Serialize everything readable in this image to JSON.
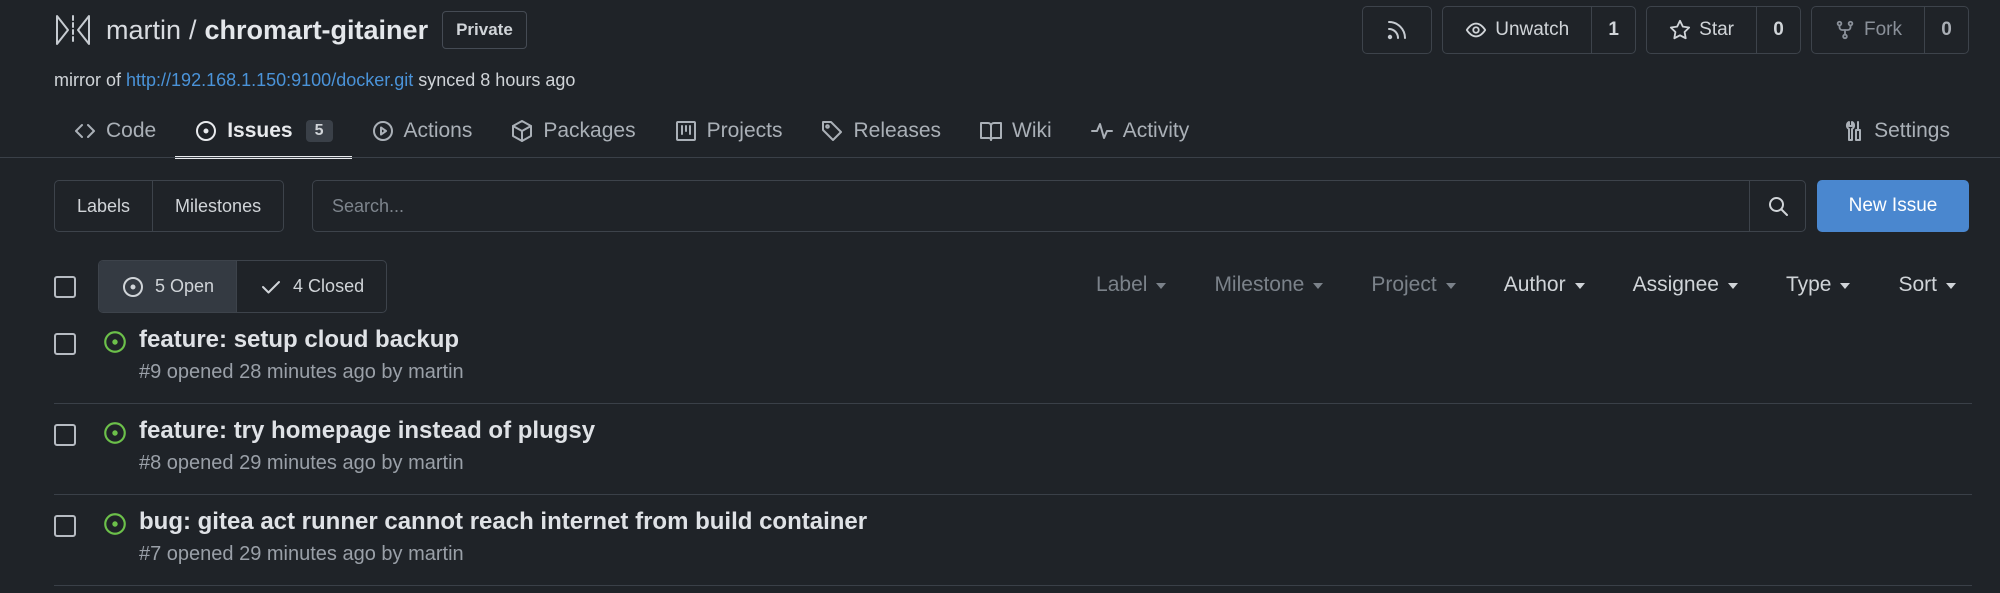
{
  "repo": {
    "owner": "martin",
    "separator": "/",
    "name": "chromart-gitainer",
    "visibility": "Private",
    "mirror_prefix": "mirror of",
    "mirror_url": "http://192.168.1.150:9100/docker.git",
    "mirror_suffix": "synced 8 hours ago"
  },
  "actions": {
    "watch_label": "Unwatch",
    "watch_count": "1",
    "star_label": "Star",
    "star_count": "0",
    "fork_label": "Fork",
    "fork_count": "0"
  },
  "tabs": [
    {
      "label": "Code",
      "icon": "code-icon"
    },
    {
      "label": "Issues",
      "icon": "issue-icon",
      "count": "5",
      "active": true
    },
    {
      "label": "Actions",
      "icon": "play-circle-icon"
    },
    {
      "label": "Packages",
      "icon": "package-icon"
    },
    {
      "label": "Projects",
      "icon": "project-board-icon"
    },
    {
      "label": "Releases",
      "icon": "tag-icon"
    },
    {
      "label": "Wiki",
      "icon": "book-icon"
    },
    {
      "label": "Activity",
      "icon": "pulse-icon"
    }
  ],
  "settings_label": "Settings",
  "toolbar": {
    "labels_label": "Labels",
    "milestones_label": "Milestones",
    "search_placeholder": "Search...",
    "new_issue_label": "New Issue"
  },
  "state": {
    "open_label": "5 Open",
    "closed_label": "4 Closed"
  },
  "filters": [
    {
      "label": "Label",
      "enabled": false
    },
    {
      "label": "Milestone",
      "enabled": false
    },
    {
      "label": "Project",
      "enabled": false
    },
    {
      "label": "Author",
      "enabled": true
    },
    {
      "label": "Assignee",
      "enabled": true
    },
    {
      "label": "Type",
      "enabled": true
    },
    {
      "label": "Sort",
      "enabled": true
    }
  ],
  "issues": [
    {
      "title": "feature: setup cloud backup",
      "meta": "#9 opened 28 minutes ago by martin"
    },
    {
      "title": "feature: try homepage instead of plugsy",
      "meta": "#8 opened 29 minutes ago by martin"
    },
    {
      "title": "bug: gitea act runner cannot reach internet from build container",
      "meta": "#7 opened 29 minutes ago by martin"
    }
  ],
  "colors": {
    "background": "#1f2328",
    "accent": "#4a87cf",
    "link": "#4a93d9",
    "open_issue": "#6cc04a"
  }
}
